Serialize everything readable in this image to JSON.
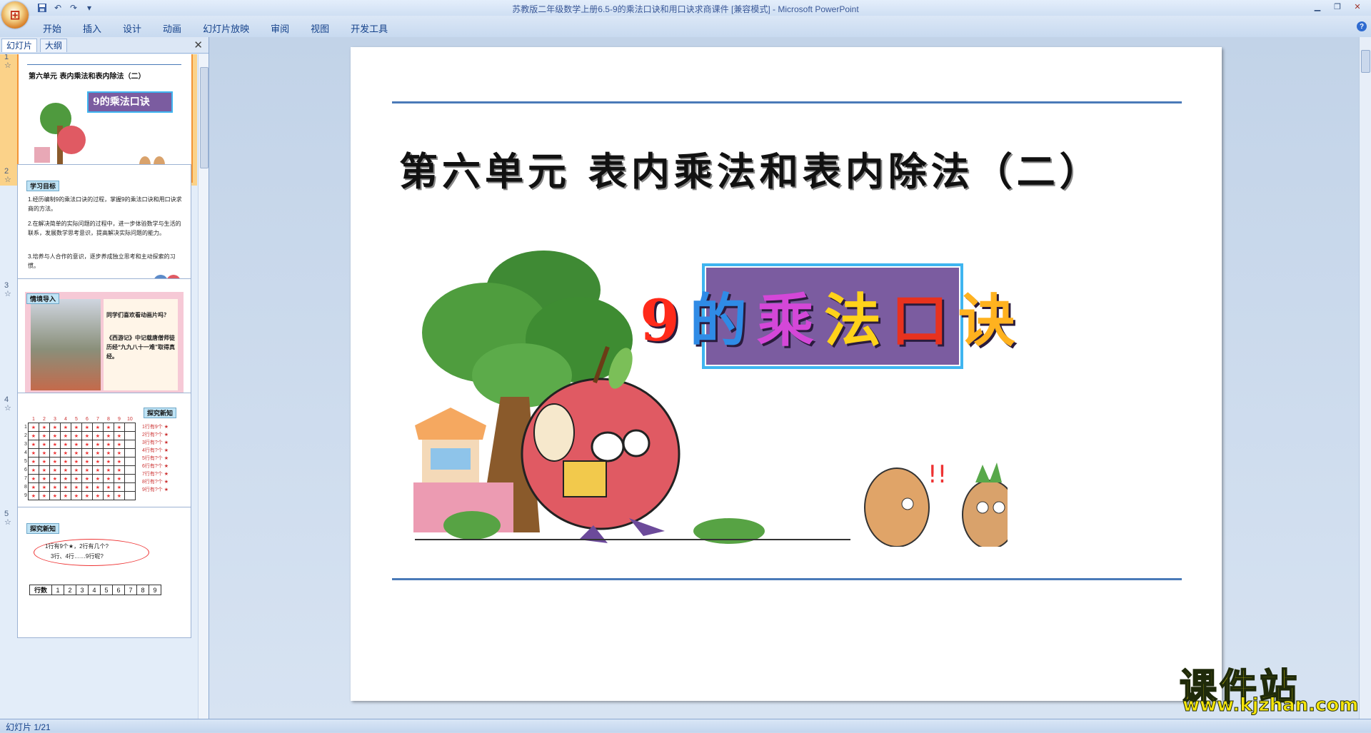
{
  "window": {
    "title": "苏教版二年级数学上册6.5-9的乘法口诀和用口诀求商课件 [兼容模式] - Microsoft PowerPoint"
  },
  "quick_access": [
    "save-icon",
    "undo-icon",
    "redo-icon",
    "customize-icon"
  ],
  "ribbon": {
    "tabs": [
      "开始",
      "插入",
      "设计",
      "动画",
      "幻灯片放映",
      "审阅",
      "视图",
      "开发工具"
    ]
  },
  "panel": {
    "tab_slides": "幻灯片",
    "tab_outline": "大纲",
    "close": "✕"
  },
  "thumbnails": [
    {
      "num": "1",
      "star": "☆",
      "title": "第六单元 表内乘法和表内除法（二）",
      "banner": "9的乘法口诀"
    },
    {
      "num": "2",
      "star": "☆",
      "label": "学习目标",
      "lines": [
        "1.经历编制9的乘法口诀的过程，掌握9的乘法口诀和用口诀求商的方法。",
        "2.在解决简单的实际问题的过程中，进一步体验数学与生活的联系，发展数学思考意识，提高解决实际问题的能力。",
        "3.培养与人合作的意识，逐步养成独立思考和主动探索的习惯。"
      ]
    },
    {
      "num": "3",
      "star": "☆",
      "label": "情境导入",
      "lines": [
        "同学们喜欢看动画片吗？",
        "《西游记》中记载唐僧师徒历经“九九八十一难”取得真经。"
      ]
    },
    {
      "num": "4",
      "star": "☆",
      "label": "探究新知",
      "cols": [
        "1",
        "2",
        "3",
        "4",
        "5",
        "6",
        "7",
        "8",
        "9",
        "10"
      ],
      "rows": [
        "1行有9个",
        "2行有?个",
        "3行有?个",
        "4行有?个",
        "5行有?个",
        "6行有?个",
        "7行有?个",
        "8行有?个",
        "9行有?个"
      ]
    },
    {
      "num": "5",
      "star": "☆",
      "label": "探究新知",
      "bubble1": "1行有9个★，2行有几个?",
      "bubble2": "3行、4行……9行呢?",
      "row_head": "行数",
      "cols": [
        "1",
        "2",
        "3",
        "4",
        "5",
        "6",
        "7",
        "8",
        "9"
      ]
    }
  ],
  "slide": {
    "title": "第六单元   表内乘法和表内除法（二）",
    "banner_chars": [
      "9",
      "的",
      "乘",
      "法",
      "口",
      "诀"
    ],
    "banner_colors": [
      "#ff2a1a",
      "#2f8be6",
      "#d447d8",
      "#ffd21a",
      "#e8321e",
      "#ffb21f"
    ]
  },
  "status": {
    "slide_indicator": "幻灯片 1/21"
  },
  "watermark": {
    "cn": "课件站",
    "url": "www.kjzhan.com"
  }
}
